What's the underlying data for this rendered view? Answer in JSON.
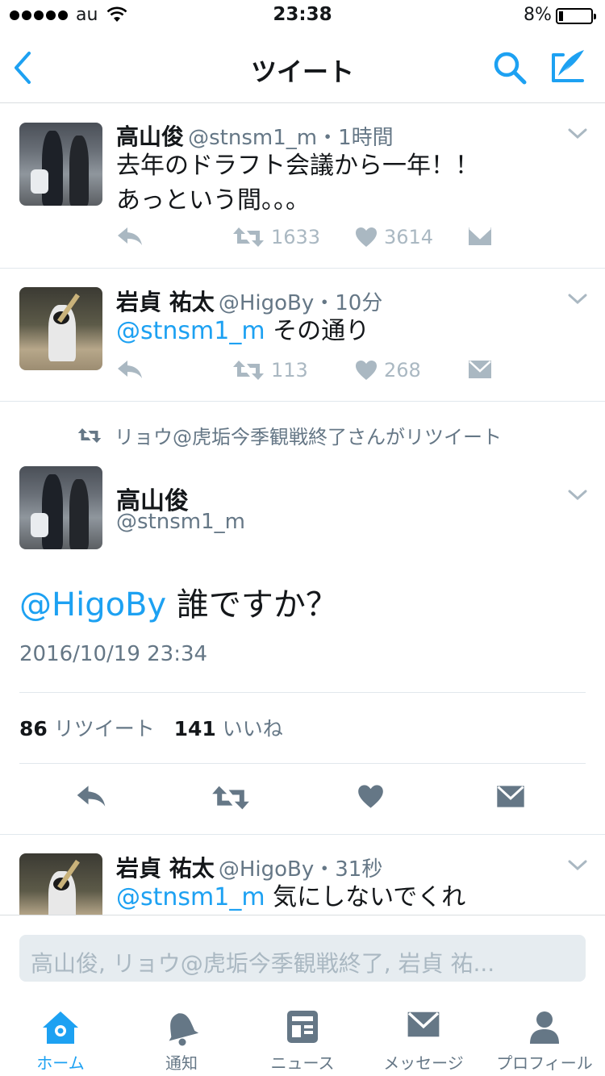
{
  "status_bar": {
    "carrier": "au",
    "time": "23:38",
    "battery": "8%"
  },
  "nav": {
    "title": "ツイート"
  },
  "tweets": [
    {
      "name": "高山俊",
      "handle": "@stnsm1_m",
      "time": "・1時間",
      "text_lines": [
        "去年のドラフト会議から一年！！",
        "あっという間。。。"
      ],
      "retweets": "1633",
      "likes": "3614"
    },
    {
      "name": "岩貞 祐太",
      "handle": "@HigoBy",
      "time": "・10分",
      "mention": "@stnsm1_m",
      "text": " その通り",
      "retweets": "113",
      "likes": "268"
    }
  ],
  "retweet_note": "リョウ@虎垢今季観戦終了さんがリツイート",
  "focus_tweet": {
    "name": "高山俊",
    "handle": "@stnsm1_m",
    "mention": "@HigoBy",
    "text": " 誰ですか？",
    "date": "2016/10/19 23:34",
    "retweet_count": "86",
    "retweet_label": "リツイート",
    "like_count": "141",
    "like_label": "いいね"
  },
  "reply_tweet": {
    "name": "岩貞 祐太",
    "handle": "@HigoBy",
    "time": "・31秒",
    "mention": "@stnsm1_m",
    "text": " 気にしないでくれ"
  },
  "reply_placeholder": "高山俊, リョウ@虎垢今季観戦終了, 岩貞 祐...",
  "tabs": [
    {
      "label": "ホーム",
      "icon": "home-icon",
      "active": true
    },
    {
      "label": "通知",
      "icon": "bell-icon"
    },
    {
      "label": "ニュース",
      "icon": "news-icon"
    },
    {
      "label": "メッセージ",
      "icon": "mail-icon"
    },
    {
      "label": "プロフィール",
      "icon": "profile-icon"
    }
  ],
  "colors": {
    "accent": "#1da1f2",
    "secondary_text": "#657786",
    "action_gray": "#aab8c2",
    "focus_action": "#657786"
  }
}
